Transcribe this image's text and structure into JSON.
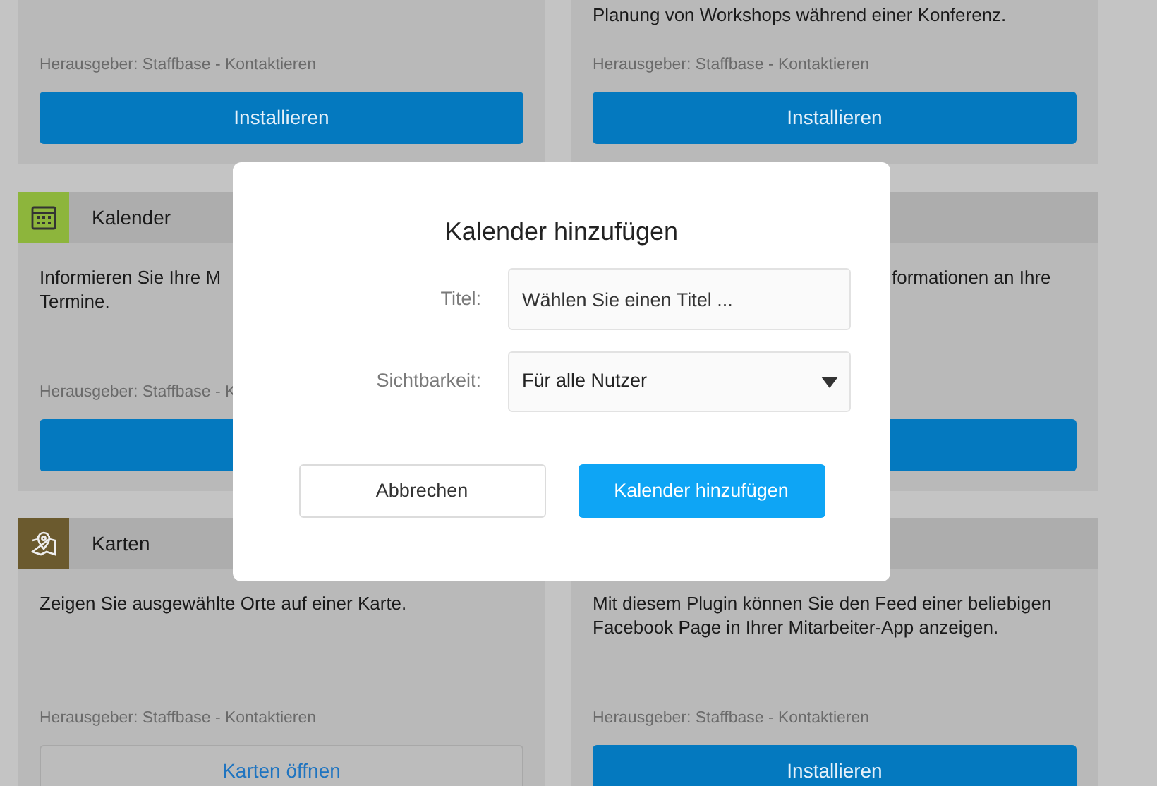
{
  "cards": [
    {
      "kind": "top",
      "publisher": "Herausgeber: Staffbase - Kontaktieren",
      "button": {
        "kind": "primary",
        "label": "Installieren"
      }
    },
    {
      "kind": "top",
      "description_lines": [
        "Planung von Workshops während einer Konferenz."
      ],
      "publisher": "Herausgeber: Staffbase - Kontaktieren",
      "button": {
        "kind": "primary",
        "label": "Installieren"
      }
    },
    {
      "kind": "full",
      "header": {
        "kind": "calendar",
        "title": "Kalender"
      },
      "description_lines": [
        "Informieren Sie Ihre M",
        "Termine."
      ],
      "publisher": "Herausgeber: Staffbase - K",
      "button": {
        "kind": "primary"
      }
    },
    {
      "kind": "full",
      "description_lines": [
        "formationen an Ihre"
      ],
      "button": {
        "kind": "primary"
      }
    },
    {
      "kind": "full",
      "header": {
        "kind": "map",
        "title": "Karten"
      },
      "description_lines": [
        "Zeigen Sie ausgewählte Orte auf einer Karte."
      ],
      "publisher": "Herausgeber: Staffbase - Kontaktieren",
      "button": {
        "kind": "secondary",
        "label": "Karten öffnen"
      }
    },
    {
      "kind": "full",
      "description_lines": [
        "Mit diesem Plugin können Sie den Feed einer beliebigen",
        "Facebook Page in Ihrer Mitarbeiter-App anzeigen."
      ],
      "publisher": "Herausgeber: Staffbase - Kontaktieren",
      "button": {
        "kind": "primary",
        "label": "Installieren"
      }
    }
  ],
  "dialog": {
    "title": "Kalender hinzufügen",
    "fields": [
      {
        "kind": "text",
        "label": "Titel:",
        "placeholder": "Wählen Sie einen Titel ..."
      },
      {
        "kind": "select",
        "label": "Sichtbarkeit:",
        "value": "Für alle Nutzer"
      }
    ],
    "buttons": [
      {
        "kind": "secondary",
        "label": "Abbrechen"
      },
      {
        "kind": "primary",
        "label": "Kalender hinzufügen"
      }
    ]
  }
}
